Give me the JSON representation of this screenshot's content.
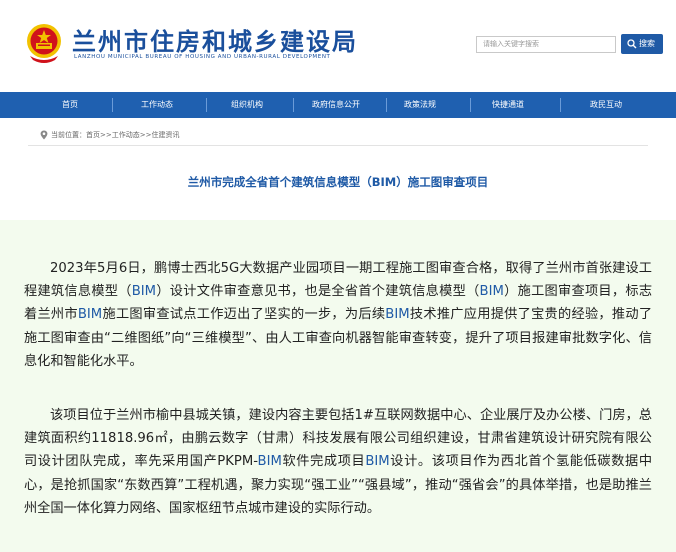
{
  "header": {
    "title": "兰州市住房和城乡建设局",
    "subtitle": "LANZHOU MUNICIPAL BUREAU OF HOUSING AND URBAN-RURAL DEVELOPMENT"
  },
  "search": {
    "placeholder": "请输入关键字搜索",
    "button_label": "搜索"
  },
  "nav": {
    "items": [
      "首页",
      "工作动态",
      "组织机构",
      "政府信息公开",
      "政策法规",
      "快捷通道",
      "政民互动"
    ]
  },
  "breadcrumb": {
    "prefix": "当前位置：",
    "path": "首页>>工作动态>>住建资讯"
  },
  "article": {
    "title": "兰州市完成全省首个建筑信息模型（BIM）施工图审查项目",
    "p1": [
      "2023年5月6日，鹏博士西北5G大数据产业园项目一期工程施工图审查合格，取得了兰州市首张建设工程建筑信息模型（",
      "BIM",
      "）设计文件审查意见书，也是全省首个建筑信息模型（",
      "BIM",
      "）施工图审查项目，标志着兰州市",
      "BIM",
      "施工图审查试点工作迈出了坚实的一步，为后续",
      "BIM",
      "技术推广应用提供了宝贵的经验，推动了施工图审查由“二维图纸”向“三维模型”、由人工审查向机器智能审查转变，提升了项目报建审批数字化、信息化和智能化水平。"
    ],
    "p2": [
      "该项目位于兰州市榆中县城关镇，建设内容主要包括1#互联网数据中心、企业展厅及办公楼、门房，总建筑面积约11818.96㎡，由鹏云数字（甘肃）科技发展有限公司组织建设，甘肃省建筑设计研究院有限公司设计团队完成，率先采用国产PKPM-",
      "BIM",
      "软件完成项目",
      "BIM",
      "设计。该项目作为西北首个氢能低碳数据中心，是抢抓国家“东数西算”工程机遇，聚力实现“强工业”“强县域”，推动“强省会”的具体举措，也是助推兰州全国一体化算力网络、国家枢纽节点城市建设的实际行动。"
    ]
  },
  "colors": {
    "brand_blue": "#1f5aa6",
    "nav_blue": "#1f60b0",
    "body_bg": "#f3fbee",
    "emblem_red": "#d0121b",
    "emblem_gold": "#f2c200"
  },
  "icons": {
    "emblem": "national-emblem-icon",
    "search": "search-icon",
    "location": "location-pin-icon"
  }
}
